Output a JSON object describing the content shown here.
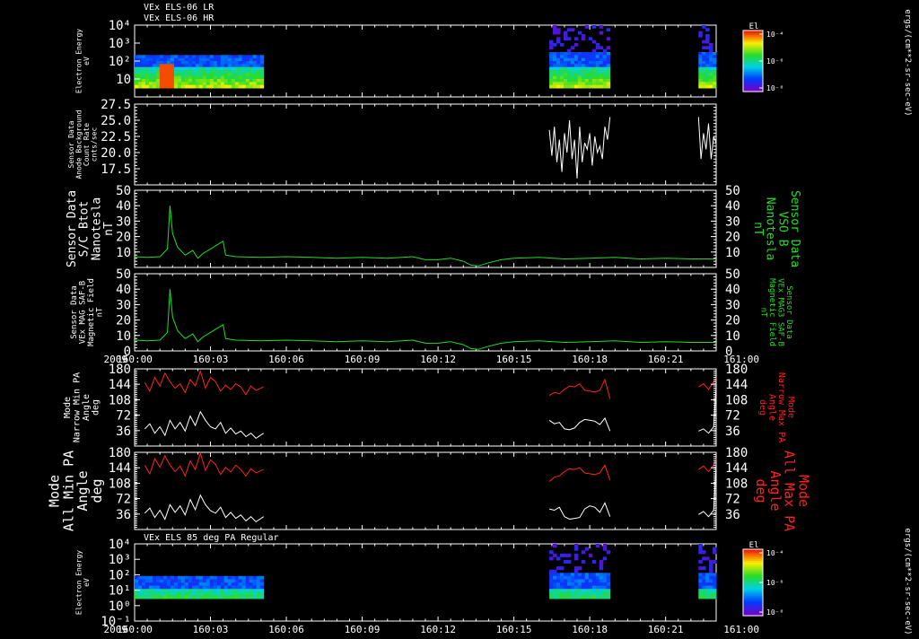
{
  "headers": {
    "top_line1": "VEx ELS-06 LR",
    "top_line2": "VEx ELS-06 HR",
    "bottom": "VEx ELS 85 deg PA Regular"
  },
  "colorbar_unit": "ergs/(cm**2-sr-sec-eV)",
  "colorbar_title": "El",
  "colors": {
    "background": "#000000",
    "axis": "#ffffff",
    "bfield": "#22dd22",
    "max_pa": "#ff2020",
    "min_pa": "#ffffff"
  },
  "chart_data": [
    {
      "type": "heatmap",
      "ylabel": [
        "Electron Energy",
        "eV"
      ],
      "yscale": "log",
      "ylim": [
        1,
        10000
      ],
      "y_ticks": [
        "10⁴",
        "10³",
        "10²",
        "10"
      ],
      "colorbar": {
        "title": "El",
        "scale": "log",
        "ticks": [
          "10⁻⁴",
          "10⁻⁶",
          "10⁻⁸"
        ]
      },
      "coverage_minutes": [
        [
          0,
          5.1
        ],
        [
          16.4,
          18.8
        ],
        [
          22.3,
          23.0
        ]
      ]
    },
    {
      "type": "line",
      "ylabel": [
        "Sensor Data",
        "Anode Background",
        "Count Rate",
        "cnts/sec"
      ],
      "ylim": [
        15,
        27.5
      ],
      "y_ticks": [
        "27.5",
        "25.0",
        "22.5",
        "20.0",
        "17.5"
      ],
      "color": "#ffffff",
      "series": [
        {
          "x": [
            16.4,
            16.5,
            16.6,
            16.7,
            16.8,
            16.9,
            17.0,
            17.1,
            17.2,
            17.3,
            17.4,
            17.5,
            17.6,
            17.7,
            17.8,
            17.9,
            18.0,
            18.1,
            18.2,
            18.3,
            18.4,
            18.5,
            18.6,
            18.7,
            18.8
          ],
          "y": [
            23.5,
            19.5,
            24,
            18.5,
            22,
            17,
            23,
            20,
            25,
            19,
            22,
            16,
            24,
            18.5,
            21.5,
            20.5,
            23,
            18,
            22.5,
            20,
            21,
            19,
            24,
            22,
            25.5
          ]
        },
        {
          "x": [
            22.3,
            22.4,
            22.5,
            22.6,
            22.7,
            22.8,
            22.9,
            23.0
          ],
          "y": [
            25.5,
            19,
            23,
            20.5,
            24.5,
            19,
            22.5,
            21.5
          ]
        }
      ]
    },
    {
      "type": "line",
      "ylabel": [
        "Sensor Data",
        "S/C Btot",
        "Nanotesla",
        "nT"
      ],
      "ylabel_right": [
        "Sensor Data",
        "VSO B",
        "Nanotesla",
        "nT"
      ],
      "ylim": [
        0,
        50
      ],
      "y_ticks": [
        "50",
        "40",
        "30",
        "20",
        "10"
      ],
      "color": "#22dd22",
      "series": [
        {
          "x": [
            0,
            0.5,
            1.0,
            1.3,
            1.4,
            1.5,
            1.7,
            2.0,
            2.3,
            2.5,
            2.7,
            3.0,
            3.3,
            3.5,
            3.6,
            4,
            5,
            6,
            7,
            8,
            9,
            10,
            11,
            11.5,
            12,
            12.5,
            13,
            13.3,
            13.6,
            14,
            14.5,
            15,
            16,
            17,
            18,
            19,
            20,
            21,
            22,
            23
          ],
          "y": [
            7,
            6.5,
            7,
            12,
            40,
            22,
            13,
            8,
            11,
            6,
            9,
            12,
            15,
            17,
            8,
            7,
            6.5,
            7,
            6.5,
            6,
            6.5,
            6,
            7,
            5,
            5,
            6,
            4,
            1.5,
            1,
            3,
            5,
            6,
            6.5,
            5.5,
            6,
            6.5,
            5.5,
            6,
            5.5,
            5.5
          ]
        }
      ]
    },
    {
      "type": "line",
      "ylabel": [
        "Sensor Data",
        "VEx MAG SAF-B",
        "Magnetic Field",
        "nT"
      ],
      "ylabel_right": [
        "Sensor Data",
        "VEx MAG3 SAF-B",
        "Magnetic Field",
        "nT"
      ],
      "ylim": [
        0,
        50
      ],
      "y_ticks": [
        "50",
        "40",
        "30",
        "20",
        "10",
        "0"
      ],
      "color": "#22dd22",
      "series": [
        {
          "x": [
            0,
            0.5,
            1.0,
            1.3,
            1.4,
            1.5,
            1.7,
            2.0,
            2.3,
            2.5,
            2.7,
            3.0,
            3.3,
            3.5,
            3.6,
            4,
            5,
            6,
            7,
            8,
            9,
            10,
            11,
            11.5,
            12,
            12.5,
            13,
            13.3,
            13.6,
            14,
            14.5,
            15,
            16,
            17,
            18,
            19,
            20,
            21,
            22,
            23
          ],
          "y": [
            7,
            6.5,
            7,
            12,
            40,
            22,
            13,
            8,
            11,
            6,
            9,
            12,
            15,
            17,
            8,
            7,
            6.5,
            7,
            6.5,
            6,
            6.5,
            6,
            7,
            5,
            5,
            6,
            4,
            1.5,
            1,
            3,
            5,
            6,
            6.5,
            5.5,
            6,
            6.5,
            5.5,
            6,
            5.5,
            5.5
          ]
        }
      ],
      "x_year": "2009",
      "x_ticks": [
        "160:00",
        "160:03",
        "160:06",
        "160:09",
        "160:12",
        "160:15",
        "160:18",
        "160:21",
        "161:00"
      ]
    },
    {
      "type": "line",
      "ylabel": [
        "Mode",
        "Narrow Min PA",
        "Angle",
        "deg"
      ],
      "ylabel_right": [
        "Mode",
        "Narrow Max PA",
        "Angle",
        "deg"
      ],
      "ylim": [
        0,
        180
      ],
      "y_ticks": [
        "180",
        "144",
        "108",
        "72",
        "36"
      ],
      "series": [
        {
          "name_color": "#ff2020",
          "x": [
            0.4,
            0.6,
            0.8,
            1.0,
            1.2,
            1.4,
            1.6,
            1.8,
            2.0,
            2.2,
            2.4,
            2.6,
            2.8,
            3.0,
            3.2,
            3.4,
            3.6,
            3.8,
            4.0,
            4.2,
            4.4,
            4.6,
            4.8,
            5.1
          ],
          "y": [
            148,
            128,
            160,
            140,
            170,
            150,
            135,
            145,
            125,
            155,
            140,
            175,
            135,
            160,
            150,
            128,
            142,
            132,
            145,
            138,
            120,
            140,
            130,
            138
          ]
        },
        {
          "name_color": "#ffffff",
          "x": [
            0.4,
            0.6,
            0.8,
            1.0,
            1.2,
            1.4,
            1.6,
            1.8,
            2.0,
            2.2,
            2.4,
            2.6,
            2.8,
            3.0,
            3.2,
            3.4,
            3.6,
            3.8,
            4.0,
            4.2,
            4.4,
            4.6,
            4.8,
            5.1
          ],
          "y": [
            40,
            52,
            30,
            45,
            25,
            60,
            40,
            55,
            35,
            70,
            48,
            80,
            60,
            45,
            40,
            55,
            30,
            42,
            28,
            35,
            22,
            30,
            18,
            30
          ]
        },
        {
          "name_color": "#ff2020",
          "x": [
            16.4,
            16.6,
            16.8,
            17.0,
            17.2,
            17.4,
            17.6,
            17.8,
            18.0,
            18.2,
            18.4,
            18.6,
            18.8
          ],
          "y": [
            118,
            125,
            122,
            132,
            140,
            138,
            145,
            130,
            128,
            126,
            130,
            155,
            110
          ]
        },
        {
          "name_color": "#ffffff",
          "x": [
            16.4,
            16.6,
            16.8,
            17.0,
            17.2,
            17.4,
            17.6,
            17.8,
            18.0,
            18.2,
            18.4,
            18.6,
            18.8
          ],
          "y": [
            60,
            52,
            55,
            40,
            38,
            42,
            55,
            62,
            60,
            58,
            50,
            65,
            35
          ]
        },
        {
          "name_color": "#ff2020",
          "x": [
            22.3,
            22.5,
            22.7,
            22.9,
            23.0
          ],
          "y": [
            138,
            145,
            132,
            150,
            160
          ]
        },
        {
          "name_color": "#ffffff",
          "x": [
            22.3,
            22.5,
            22.7,
            22.9,
            23.0
          ],
          "y": [
            35,
            40,
            30,
            45,
            140
          ]
        }
      ]
    },
    {
      "type": "line",
      "ylabel": [
        "Mode",
        "All Min PA",
        "Angle",
        "deg"
      ],
      "ylabel_right": [
        "Mode",
        "All Max PA",
        "Angle",
        "deg"
      ],
      "ylim": [
        0,
        180
      ],
      "y_ticks": [
        "180",
        "144",
        "108",
        "72",
        "36"
      ],
      "series": [
        {
          "name_color": "#ff2020",
          "x": [
            0.4,
            0.6,
            0.8,
            1.0,
            1.2,
            1.4,
            1.6,
            1.8,
            2.0,
            2.2,
            2.4,
            2.6,
            2.8,
            3.0,
            3.2,
            3.4,
            3.6,
            3.8,
            4.0,
            4.2,
            4.4,
            4.6,
            4.8,
            5.1
          ],
          "y": [
            150,
            130,
            165,
            145,
            172,
            150,
            135,
            148,
            125,
            160,
            140,
            178,
            138,
            162,
            152,
            128,
            145,
            134,
            150,
            140,
            125,
            142,
            132,
            140
          ]
        },
        {
          "name_color": "#ffffff",
          "x": [
            0.4,
            0.6,
            0.8,
            1.0,
            1.2,
            1.4,
            1.6,
            1.8,
            2.0,
            2.2,
            2.4,
            2.6,
            2.8,
            3.0,
            3.2,
            3.4,
            3.6,
            3.8,
            4.0,
            4.2,
            4.4,
            4.6,
            4.8,
            5.1
          ],
          "y": [
            38,
            50,
            28,
            45,
            24,
            58,
            40,
            55,
            34,
            70,
            46,
            80,
            58,
            44,
            38,
            52,
            28,
            40,
            26,
            34,
            20,
            30,
            18,
            30
          ]
        },
        {
          "name_color": "#ff2020",
          "x": [
            16.4,
            16.6,
            16.8,
            17.0,
            17.2,
            17.4,
            17.6,
            17.8,
            18.0,
            18.2,
            18.4,
            18.6,
            18.8
          ],
          "y": [
            112,
            122,
            125,
            135,
            142,
            140,
            144,
            132,
            130,
            128,
            132,
            150,
            115
          ]
        },
        {
          "name_color": "#ffffff",
          "x": [
            16.4,
            16.6,
            16.8,
            17.0,
            17.2,
            17.4,
            17.6,
            17.8,
            18.0,
            18.2,
            18.4,
            18.6,
            18.8
          ],
          "y": [
            48,
            45,
            52,
            30,
            24,
            26,
            28,
            48,
            55,
            52,
            40,
            62,
            30
          ]
        },
        {
          "name_color": "#ff2020",
          "x": [
            22.3,
            22.5,
            22.7,
            22.9,
            23.0
          ],
          "y": [
            140,
            148,
            135,
            150,
            165
          ]
        },
        {
          "name_color": "#ffffff",
          "x": [
            22.3,
            22.5,
            22.7,
            22.9,
            23.0
          ],
          "y": [
            35,
            42,
            30,
            45,
            150
          ]
        }
      ]
    },
    {
      "type": "heatmap",
      "ylabel": [
        "Electron Energy",
        "eV"
      ],
      "yscale": "log",
      "ylim": [
        0.1,
        10000
      ],
      "y_ticks": [
        "10⁴",
        "10³",
        "10²",
        "10¹",
        "10⁰",
        "10⁻¹"
      ],
      "colorbar": {
        "title": "El",
        "scale": "log",
        "ticks": [
          "10⁻⁴",
          "10⁻⁶",
          "10⁻⁸"
        ]
      },
      "coverage_minutes": [
        [
          0,
          5.1
        ],
        [
          16.4,
          18.8
        ],
        [
          22.3,
          23.0
        ]
      ],
      "x_year": "2009",
      "x_ticks": [
        "160:00",
        "160:03",
        "160:06",
        "160:09",
        "160:12",
        "160:15",
        "160:18",
        "160:21",
        "161:00"
      ]
    }
  ]
}
